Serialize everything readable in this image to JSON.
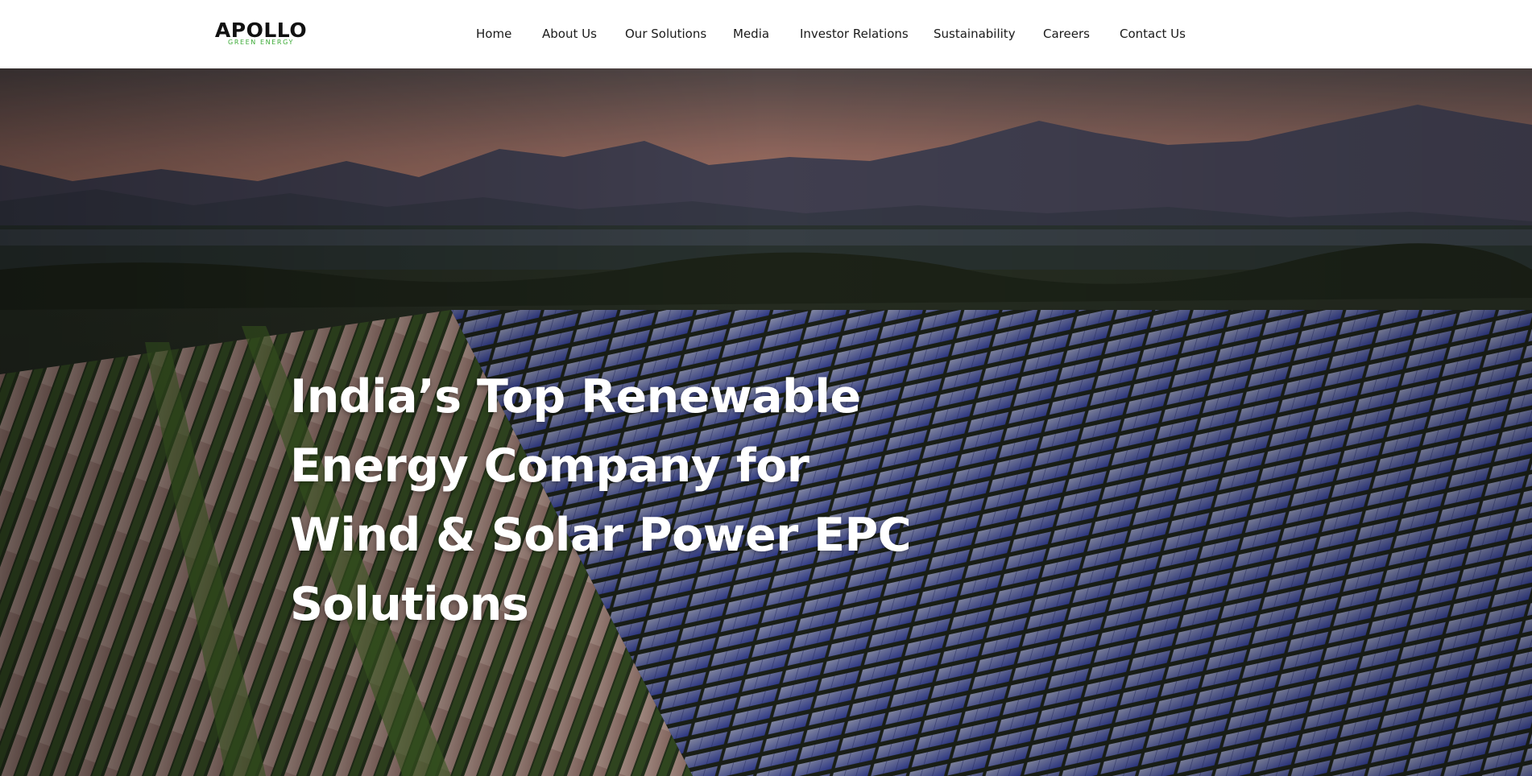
{
  "header": {
    "logo": {
      "name": "APOLLO",
      "tagline": "GREEN ENERGY",
      "tagline_color": "#3aaa35"
    },
    "nav": [
      {
        "label": "Home"
      },
      {
        "label": "About Us"
      },
      {
        "label": "Our Solutions"
      },
      {
        "label": "Media"
      },
      {
        "label": "Investor Relations"
      },
      {
        "label": "Sustainability"
      },
      {
        "label": "Careers"
      },
      {
        "label": "Contact Us"
      }
    ]
  },
  "hero": {
    "heading_lines": [
      "India’s Top Renewable",
      "Energy Company for",
      "Wind & Solar Power EPC",
      "Solutions"
    ],
    "background": "solar-farm-photo"
  },
  "colors": {
    "nav_text": "#1a1a1a",
    "hero_text": "#ffffff",
    "sky_top": "#6b5a52",
    "sky_glow": "#c8806a",
    "panel_blue": "#3b4a9a"
  }
}
